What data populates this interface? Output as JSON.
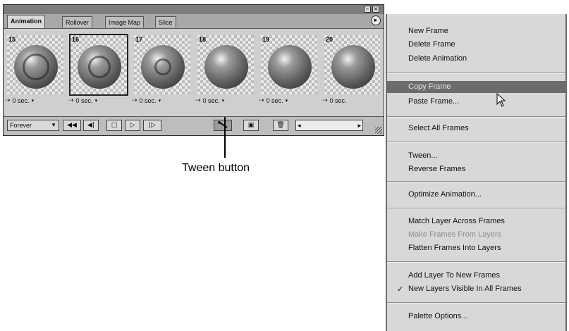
{
  "palette": {
    "window_buttons": {
      "minimize": "–",
      "close": "×"
    },
    "tabs": [
      {
        "label": "Animation",
        "active": true
      },
      {
        "label": "Rollover",
        "active": false
      },
      {
        "label": "Image Map",
        "active": false
      },
      {
        "label": "Slice",
        "active": false
      }
    ],
    "menu_button_icon": "►",
    "frames": [
      {
        "number": "15",
        "delay": "0 sec.",
        "sphere": "ringed-1",
        "selected": false
      },
      {
        "number": "16",
        "delay": "0 sec.",
        "sphere": "ringed-2",
        "selected": true
      },
      {
        "number": "17",
        "delay": "0 sec.",
        "sphere": "ringed-3",
        "selected": false
      },
      {
        "number": "18",
        "delay": "0 sec.",
        "sphere": "plain",
        "selected": false
      },
      {
        "number": "19",
        "delay": "0 sec.",
        "sphere": "plain",
        "selected": false
      },
      {
        "number": "20",
        "delay": "0 sec.",
        "sphere": "plain",
        "selected": false
      }
    ],
    "controls": {
      "loop_option": "Forever",
      "first_frame_icon": "◀◀",
      "previous_frame_icon": "◀|",
      "stop_icon": "□",
      "play_icon": "▷",
      "next_frame_icon": "|▷",
      "tween_icon": "tween-icon",
      "duplicate_icon": "▣",
      "delete_icon": "🗑",
      "scroll_left": "◂",
      "scroll_right": "▸"
    }
  },
  "callout": {
    "label": "Tween button"
  },
  "menu": {
    "items": {
      "new_frame": "New Frame",
      "delete_frame": "Delete Frame",
      "delete_animation": "Delete Animation",
      "copy_frame": "Copy Frame",
      "paste_frame": "Paste Frame...",
      "select_all_frames": "Select All Frames",
      "tween": "Tween...",
      "reverse_frames": "Reverse Frames",
      "optimize_animation": "Optimize Animation...",
      "match_layer": "Match Layer Across Frames",
      "make_frames_from_layers": "Make Frames From Layers",
      "flatten_frames": "Flatten Frames Into Layers",
      "add_layer_to_new_frames": "Add Layer To New Frames",
      "new_layers_visible": "New Layers Visible In All Frames",
      "palette_options": "Palette Options..."
    },
    "check_mark": "✓",
    "highlighted_item": "Copy Frame",
    "disabled_item": "Make Frames From Layers"
  }
}
